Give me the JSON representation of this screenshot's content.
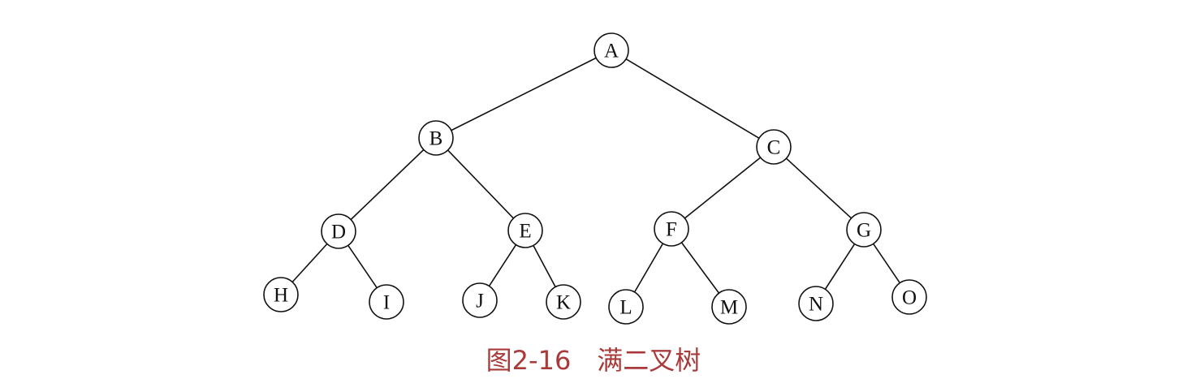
{
  "diagram": {
    "type": "full-binary-tree",
    "nodes": [
      {
        "id": "A",
        "label": "A"
      },
      {
        "id": "B",
        "label": "B"
      },
      {
        "id": "C",
        "label": "C"
      },
      {
        "id": "D",
        "label": "D"
      },
      {
        "id": "E",
        "label": "E"
      },
      {
        "id": "F",
        "label": "F"
      },
      {
        "id": "G",
        "label": "G"
      },
      {
        "id": "H",
        "label": "H"
      },
      {
        "id": "I",
        "label": "I"
      },
      {
        "id": "J",
        "label": "J"
      },
      {
        "id": "K",
        "label": "K"
      },
      {
        "id": "L",
        "label": "L"
      },
      {
        "id": "M",
        "label": "M"
      },
      {
        "id": "N",
        "label": "N"
      },
      {
        "id": "O",
        "label": "O"
      }
    ],
    "edges": [
      [
        "A",
        "B"
      ],
      [
        "A",
        "C"
      ],
      [
        "B",
        "D"
      ],
      [
        "B",
        "E"
      ],
      [
        "C",
        "F"
      ],
      [
        "C",
        "G"
      ],
      [
        "D",
        "H"
      ],
      [
        "D",
        "I"
      ],
      [
        "E",
        "J"
      ],
      [
        "E",
        "K"
      ],
      [
        "F",
        "L"
      ],
      [
        "F",
        "M"
      ],
      [
        "G",
        "N"
      ],
      [
        "G",
        "O"
      ]
    ],
    "colors": {
      "caption": "#a83a3a",
      "stroke": "#111111",
      "node_fill": "#ffffff"
    }
  },
  "caption": {
    "text": "图2-16　满二叉树"
  }
}
